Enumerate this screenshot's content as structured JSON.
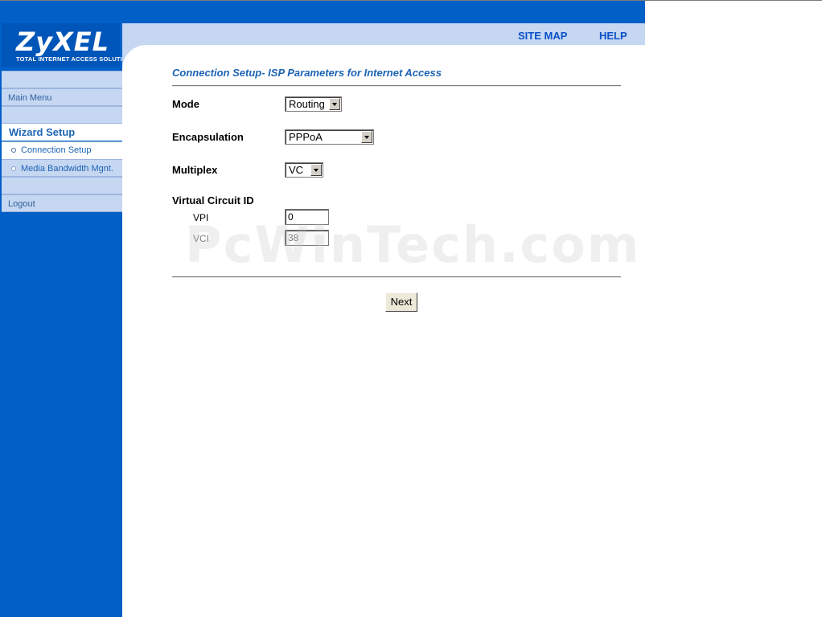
{
  "brand": {
    "logo": "ZyXEL",
    "tagline": "TOTAL INTERNET ACCESS SOLUTION"
  },
  "toplinks": {
    "site_map": "SITE MAP",
    "help": "HELP"
  },
  "sidebar": {
    "main_menu": "Main Menu",
    "wizard_setup": "Wizard Setup",
    "items": [
      {
        "label": "Connection Setup"
      },
      {
        "label": "Media Bandwidth Mgnt."
      }
    ],
    "logout": "Logout"
  },
  "page": {
    "title": "Connection Setup- ISP Parameters for Internet Access",
    "mode": {
      "label": "Mode",
      "value": "Routing"
    },
    "encapsulation": {
      "label": "Encapsulation",
      "value": "PPPoA"
    },
    "multiplex": {
      "label": "Multiplex",
      "value": "VC"
    },
    "virtual_circuit": {
      "label": "Virtual Circuit ID",
      "vpi": {
        "label": "VPI",
        "value": "0"
      },
      "vci": {
        "label": "VCI",
        "value": "38"
      }
    },
    "next_button": "Next"
  },
  "watermark": "PcWinTech.com",
  "colors": {
    "brand_blue": "#0060c8",
    "light_band": "#c6d7f2",
    "title_blue": "#1c64b4"
  }
}
